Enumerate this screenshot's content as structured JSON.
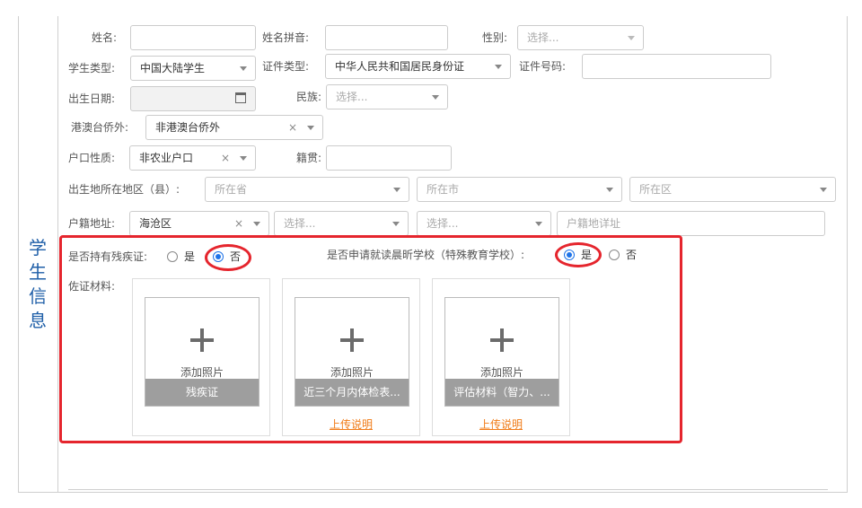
{
  "section_title": [
    "学",
    "生",
    "信",
    "息"
  ],
  "row1": {
    "name_label": "姓名:",
    "pinyin_label": "姓名拼音:",
    "gender_label": "性别:",
    "gender_placeholder": "选择..."
  },
  "row2": {
    "student_type_label": "学生类型:",
    "student_type_value": "中国大陆学生",
    "id_type_label": "证件类型:",
    "id_type_value": "中华人民共和国居民身份证",
    "id_number_label": "证件号码:"
  },
  "row3": {
    "birth_date_label": "出生日期:",
    "ethnicity_label": "民族:",
    "ethnicity_placeholder": "选择..."
  },
  "row4": {
    "hk_label": "港澳台侨外:",
    "hk_value": "非港澳台侨外"
  },
  "row5": {
    "hukou_type_label": "户口性质:",
    "hukou_type_value": "非农业户口",
    "native_place_label": "籍贯:"
  },
  "row6": {
    "birthplace_label": "出生地所在地区（县）:",
    "province_placeholder": "所在省",
    "city_placeholder": "所在市",
    "district_placeholder": "所在区"
  },
  "row7": {
    "hukou_addr_label": "户籍地址:",
    "hukou_district_value": "海沧区",
    "select2_placeholder": "选择...",
    "select3_placeholder": "选择...",
    "detail_placeholder": "户籍地详址"
  },
  "disability": {
    "label": "是否持有残疾证:",
    "yes": "是",
    "no": "否",
    "selected": "否"
  },
  "special_school": {
    "label": "是否申请就读晨昕学校（特殊教育学校）:",
    "yes": "是",
    "no": "否",
    "selected": "是"
  },
  "materials_label": "佐证材料:",
  "cards": [
    {
      "add_text": "添加照片",
      "caption": "残疾证",
      "link": ""
    },
    {
      "add_text": "添加照片",
      "caption": "近三个月内体检表...",
      "link": "上传说明"
    },
    {
      "add_text": "添加照片",
      "caption": "评估材料（智力、...",
      "link": "上传说明"
    }
  ],
  "colors": {
    "accent": "#1f73e8",
    "highlight": "#e5252d",
    "link": "#f07b17",
    "title": "#1f5fa8"
  }
}
